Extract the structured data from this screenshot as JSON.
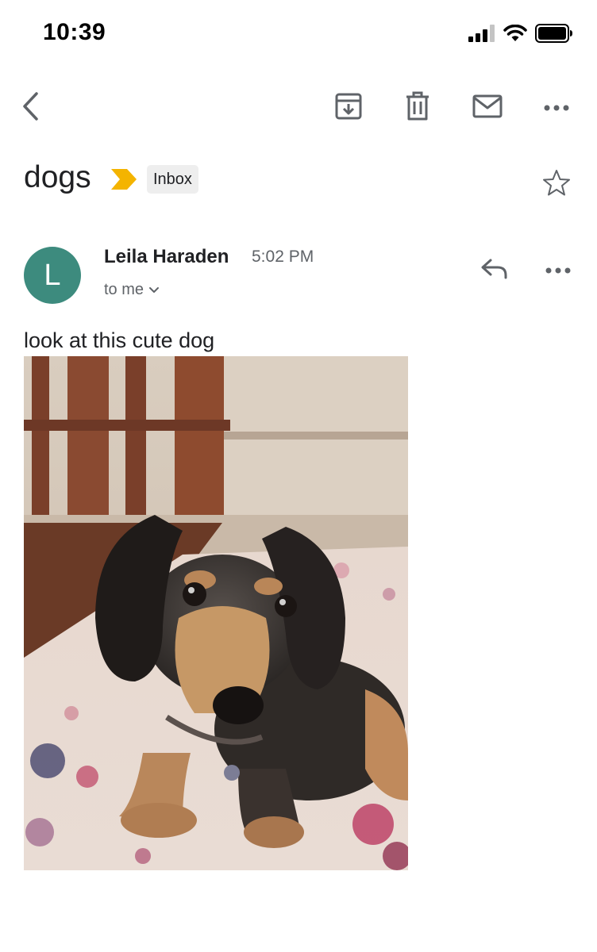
{
  "status_bar": {
    "time": "10:39",
    "icons": [
      "cellular-signal-icon",
      "wifi-icon",
      "battery-icon"
    ]
  },
  "toolbar": {
    "actions": [
      "back-icon",
      "archive-icon",
      "delete-icon",
      "mark-unread-icon",
      "more-icon"
    ]
  },
  "message": {
    "subject": "dogs",
    "label": "Inbox",
    "importance_color": "#f4b400",
    "sender": {
      "initial": "L",
      "name": "Leila Haraden",
      "avatar_color": "#3d8b7e"
    },
    "time": "5:02 PM",
    "recipient": "to me",
    "body": "look at this cute dog"
  }
}
